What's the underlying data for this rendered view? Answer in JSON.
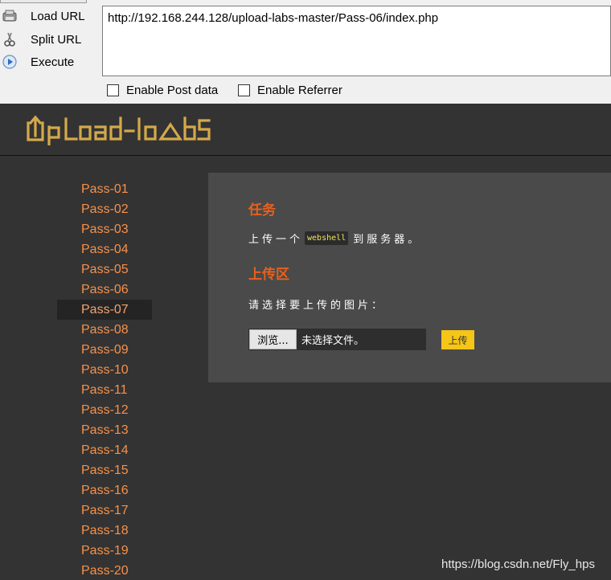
{
  "hackbar": {
    "load_url": "Load URL",
    "split_url": "Split URL",
    "execute": "Execute",
    "url": "http://192.168.244.128/upload-labs-master/Pass-06/index.php",
    "enable_post": "Enable Post data",
    "enable_referrer": "Enable Referrer"
  },
  "site": {
    "logo": "UpLoad-labs",
    "brand_color": "#d4a94a"
  },
  "sidebar": {
    "items": [
      "Pass-01",
      "Pass-02",
      "Pass-03",
      "Pass-04",
      "Pass-05",
      "Pass-06",
      "Pass-07",
      "Pass-08",
      "Pass-09",
      "Pass-10",
      "Pass-11",
      "Pass-12",
      "Pass-13",
      "Pass-14",
      "Pass-15",
      "Pass-16",
      "Pass-17",
      "Pass-18",
      "Pass-19",
      "Pass-20"
    ],
    "active": "Pass-07",
    "link_color": "#f6914b"
  },
  "main": {
    "task_heading": "任务",
    "task_prefix": "上传一个",
    "task_code": "webshell",
    "task_suffix": "到服务器。",
    "upload_heading": "上传区",
    "upload_prompt": "请选择要上传的图片：",
    "browse_label": "浏览...",
    "file_status": "未选择文件。",
    "submit_label": "上传",
    "heading_color": "#e8601c",
    "submit_color": "#f5c518"
  },
  "watermark": "https://blog.csdn.net/Fly_hps"
}
